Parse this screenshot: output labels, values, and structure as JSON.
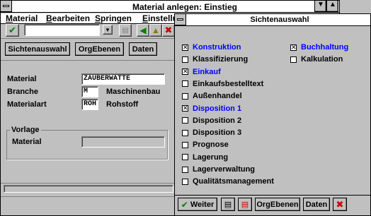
{
  "main": {
    "title": "Material anlegen: Einstieg",
    "menu": {
      "m1": {
        "u": "M",
        "rest": "aterial"
      },
      "m2": {
        "u": "B",
        "rest": "earbeiten"
      },
      "m3": {
        "u": "S",
        "rest": "pringen"
      },
      "m4": {
        "u": "E",
        "rest": "instellu"
      }
    },
    "toolbar": {
      "command_value": ""
    },
    "buttons": {
      "sichtenauswahl": "Sichtenauswahl",
      "orgebenen": "OrgEbenen",
      "daten": "Daten"
    },
    "fields": {
      "material_label": "Material",
      "material_value": "ZAUBERWATTE",
      "branche_label": "Branche",
      "branche_code": "M",
      "branche_text": "Maschinenbau",
      "materialart_label": "Materialart",
      "materialart_code": "ROH",
      "materialart_text": "Rohstoff"
    },
    "vorlage": {
      "group_label": "Vorlage",
      "material_label": "Material",
      "material_value": ""
    }
  },
  "dialog": {
    "title": "Sichtenauswahl",
    "left_items": [
      {
        "label": "Konstruktion",
        "checked": true,
        "highlight": true
      },
      {
        "label": "Klassifizierung",
        "checked": false,
        "highlight": false
      },
      {
        "label": "Einkauf",
        "checked": true,
        "highlight": true
      },
      {
        "label": "Einkaufsbestelltext",
        "checked": false,
        "highlight": false
      },
      {
        "label": "Außenhandel",
        "checked": false,
        "highlight": false
      },
      {
        "label": "Disposition 1",
        "checked": true,
        "highlight": true
      },
      {
        "label": "Disposition 2",
        "checked": false,
        "highlight": false
      },
      {
        "label": "Disposition 3",
        "checked": false,
        "highlight": false
      },
      {
        "label": "Prognose",
        "checked": false,
        "highlight": false
      },
      {
        "label": "Lagerung",
        "checked": false,
        "highlight": false
      },
      {
        "label": "Lagerverwaltung",
        "checked": false,
        "highlight": false
      },
      {
        "label": "Qualitätsmanagement",
        "checked": false,
        "highlight": false
      }
    ],
    "right_items": [
      {
        "label": "Buchhaltung",
        "checked": true,
        "highlight": true
      },
      {
        "label": "Kalkulation",
        "checked": false,
        "highlight": false
      }
    ],
    "buttons": {
      "weiter": "Weiter",
      "orgebenen": "OrgEbenen",
      "daten": "Daten"
    }
  },
  "colors": {
    "highlight": "#0000ff",
    "ok_green": "#008000",
    "cancel_red": "#d00000",
    "page_bg": "#c0c0c0"
  }
}
